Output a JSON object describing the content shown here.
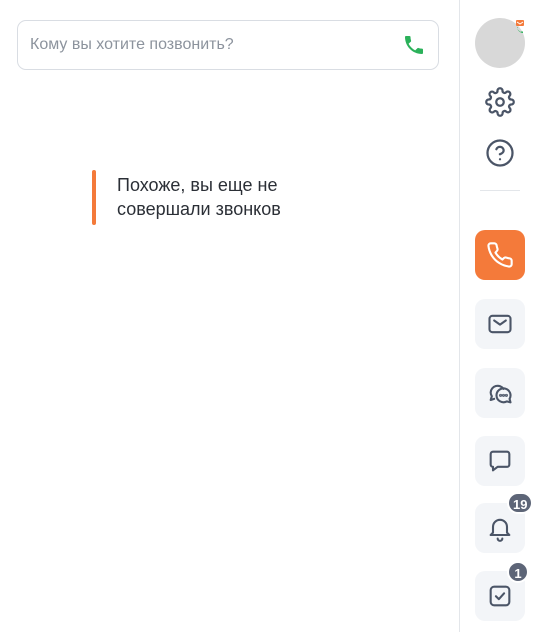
{
  "search": {
    "placeholder": "Кому вы хотите позвонить?",
    "value": ""
  },
  "empty_state": {
    "message": "Похоже, вы еще не совершали звонков"
  },
  "sidebar": {
    "notifications_count": "19",
    "tasks_count": "1"
  },
  "colors": {
    "accent": "#f47a3a",
    "call_green": "#2bb15a",
    "badge": "#5d6577",
    "icon": "#4b5567"
  },
  "icons": {
    "call": "phone-icon",
    "settings": "gear-icon",
    "help": "question-icon",
    "calls": "phone-icon",
    "mail": "envelope-icon",
    "chats": "chat-bubbles-icon",
    "messages": "message-square-icon",
    "notifications": "bell-icon",
    "tasks": "checkbox-icon"
  }
}
